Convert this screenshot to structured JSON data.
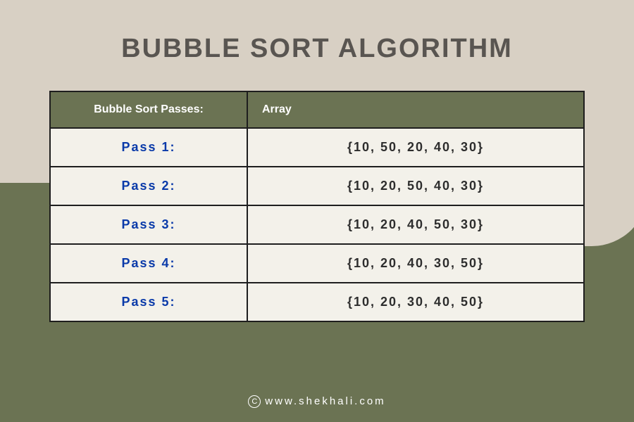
{
  "title": "BUBBLE SORT ALGORITHM",
  "table": {
    "headers": {
      "passes": "Bubble Sort Passes:",
      "array": "Array"
    },
    "rows": [
      {
        "pass": "Pass 1:",
        "array": "{10, 50, 20, 40, 30}"
      },
      {
        "pass": "Pass 2:",
        "array": "{10, 20, 50, 40, 30}"
      },
      {
        "pass": "Pass 3:",
        "array": "{10, 20, 40, 50, 30}"
      },
      {
        "pass": "Pass 4:",
        "array": "{10, 20, 40, 30, 50}"
      },
      {
        "pass": "Pass 5:",
        "array": "{10, 20, 30, 40, 50}"
      }
    ]
  },
  "footer": {
    "copyright_symbol": "C",
    "site": "www.shekhali.com"
  },
  "colors": {
    "beige": "#d8d0c4",
    "olive": "#6b7353",
    "title": "#595551",
    "pass_label": "#0a3aa9",
    "row_bg": "#f3f1ea"
  }
}
